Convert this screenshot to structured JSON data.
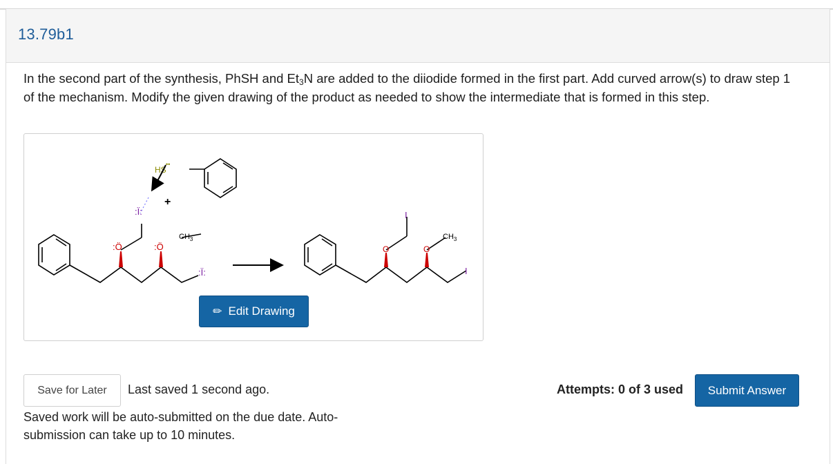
{
  "question": {
    "id": "13.79b1",
    "prompt_part1": "In the second part of the synthesis, PhSH and Et",
    "prompt_sub1": "3",
    "prompt_part2": "N are added to the diiodide formed in the first part. Add curved arrow(s) to draw step 1 of the mechanism. Modify the given drawing of the product as needed to show the intermediate that is formed in this step."
  },
  "drawing": {
    "edit_label": "Edit Drawing",
    "edit_icon": "pencil-icon",
    "labels": {
      "hs": "HS",
      "plus": "+",
      "ch3": "CH",
      "ch3_sub": "3",
      "o": "O",
      "i": "I",
      "lone_pair_o": ":Ö",
      "lone_pair_i": ":Ï:"
    }
  },
  "footer": {
    "save_later": "Save for Later",
    "last_saved": "Last saved 1 second ago.",
    "auto_submit": "Saved work will be auto-submitted on the due date. Auto-submission can take up to 10 minutes.",
    "attempts": "Attempts: 0 of 3 used",
    "submit": "Submit Answer"
  },
  "colors": {
    "accent": "#1565a4",
    "title": "#1f5d99",
    "oxygen": "#cc0000",
    "iodine": "#7b1fa2",
    "sulfur": "#8a8a00"
  }
}
